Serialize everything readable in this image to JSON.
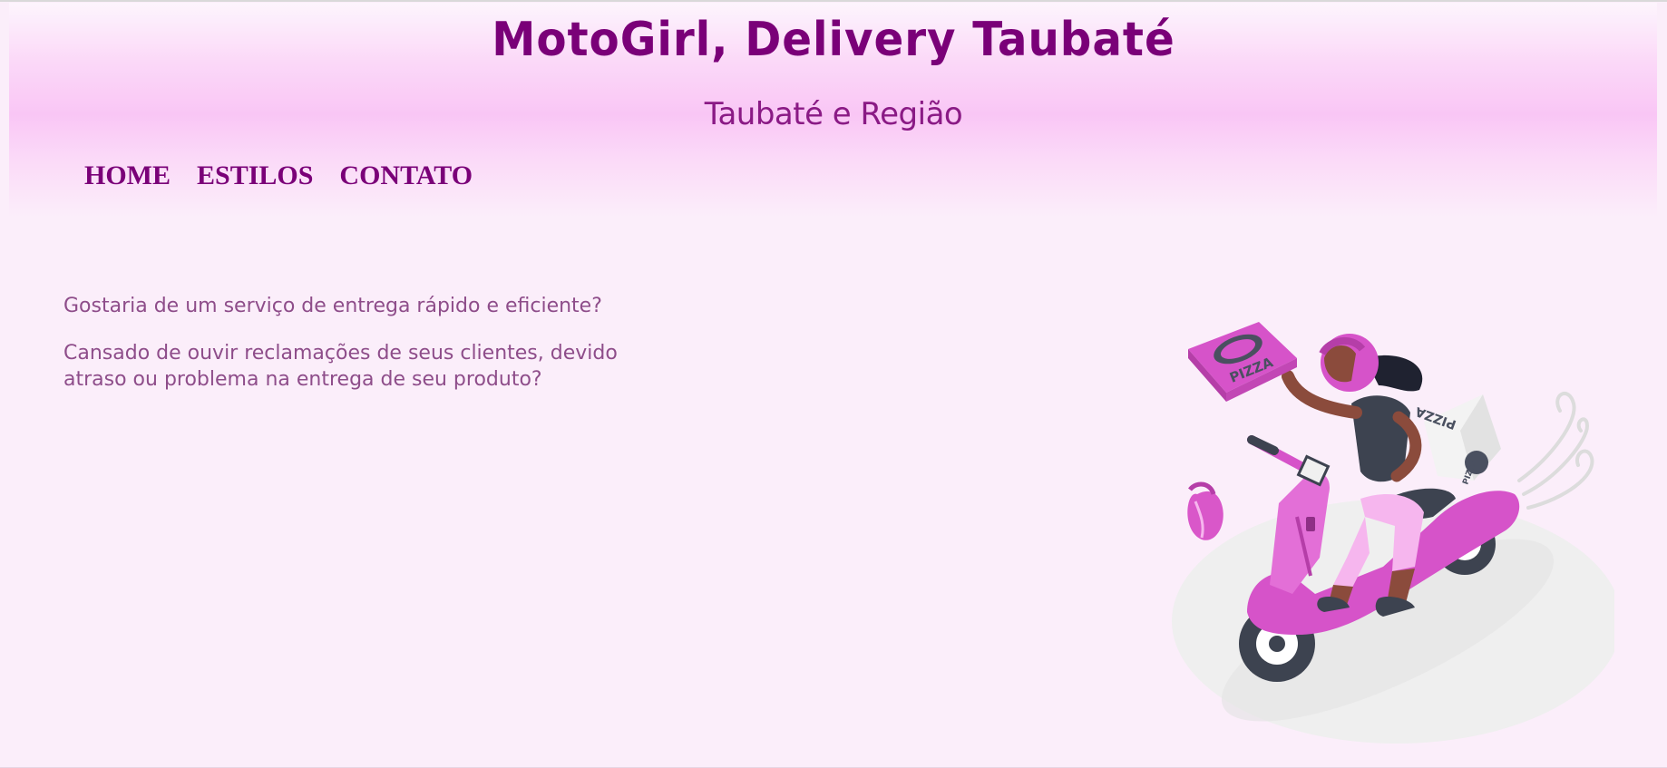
{
  "header": {
    "title": "MotoGirl, Delivery Taubaté",
    "subtitle": "Taubaté e Região"
  },
  "nav": {
    "items": [
      {
        "label": "HOME"
      },
      {
        "label": "ESTILOS"
      },
      {
        "label": "CONTATO"
      }
    ]
  },
  "main": {
    "paragraphs": [
      "Gostaria de um serviço de entrega rápido e eficiente?",
      "Cansado de ouvir reclamações de seus clientes, devido atraso ou problema na entrega de seu produto?"
    ]
  },
  "illustration": {
    "pizza_label": "PIZZA",
    "icon": "pizza-delivery-scooter-illustration"
  },
  "colors": {
    "brand": "#7a0078",
    "background": "#fbeefa",
    "header_gradient_center": "#f9c6f5",
    "body_text": "#8e4d8a",
    "scooter": "#d653c9"
  }
}
